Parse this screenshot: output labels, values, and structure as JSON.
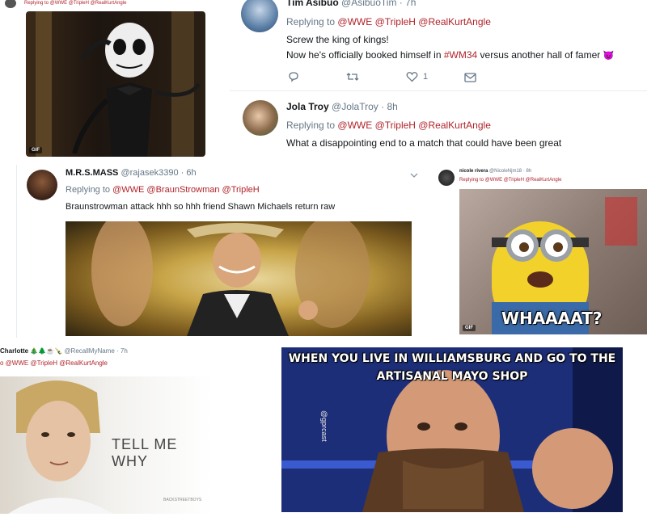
{
  "collage": {
    "panel_jack": {
      "reply_line": "Replying to @WWE @TripleH @RealKurtAngle",
      "gif_badge": "GIF"
    },
    "tweet_tim": {
      "display_name": "Tim Asibuo",
      "handle": "@AsibuoTim",
      "time": "· 7h",
      "replying_prefix": "Replying to",
      "replying_mentions": "@WWE @TripleH @RealKurtAngle",
      "line1": "Screw the king of kings!",
      "line2_pre": "Now he's officially booked himself in ",
      "line2_hashtag": "#WM34",
      "line2_post": " versus another hall of famer",
      "emoji": "😈",
      "like_count": "1",
      "icons": [
        "reply-icon",
        "retweet-icon",
        "like-icon",
        "message-icon"
      ]
    },
    "tweet_jola": {
      "display_name": "Jola Troy",
      "handle": "@JolaTroy",
      "time": "· 8h",
      "replying_prefix": "Replying to",
      "replying_mentions": "@WWE @TripleH @RealKurtAngle",
      "text": "What a disappointing end to a match that could have been great"
    },
    "tweet_mass": {
      "display_name": "M.R.S.MASS",
      "handle": "@rajasek3390",
      "time": "· 6h",
      "replying_prefix": "Replying to",
      "replying_mentions": "@WWE @BraunStrowman @TripleH",
      "text": "Braunstrowman attack hhh so hhh friend Shawn Michaels return raw"
    },
    "tweet_nicole": {
      "display_name": "nicole rivera",
      "handle": "@NicoleNjm18",
      "time": "· 8h",
      "replying_line": "Replying to @WWE @TripleH @RealKurtAngle",
      "meme_text": "WHAAAAT?",
      "gif_badge": "GIF"
    },
    "tweet_charlotte": {
      "display_name": "Charlotte",
      "emoji_row": "🎄🌲☕️🍾",
      "handle": "@RecallMyName",
      "time": "· 7h",
      "replying_line": "o @WWE @TripleH @RealKurtAngle",
      "image_text": "TELL ME WHY",
      "image_watermark": "BACKSTREETBOYS"
    },
    "meme_braun": {
      "top_line1": "WHEN YOU LIVE IN WILLIAMSBURG AND GO TO THE",
      "top_line2": "ARTISANAL MAYO SHOP",
      "watermark": "@gprcast"
    },
    "colors": {
      "mention": "#b0232a",
      "muted": "#657786",
      "text": "#14171a"
    }
  }
}
